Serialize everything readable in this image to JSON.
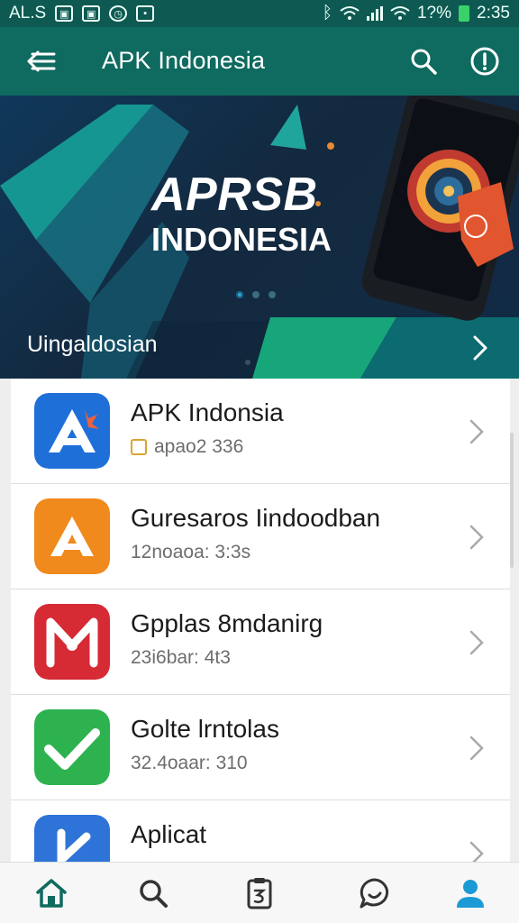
{
  "status_bar": {
    "carrier": "AL.S",
    "icons": [
      "image-icon",
      "image-icon",
      "clock-icon",
      "notification-icon",
      "bluetooth-icon",
      "wifi-icon",
      "signal-icon",
      "wifi-icon"
    ],
    "battery": "1?%",
    "time": "2:35"
  },
  "app_bar": {
    "title": "APK Indonesia",
    "back_icon": "back-menu-icon",
    "search_icon": "search-icon",
    "info_icon": "info-icon",
    "color": "#0f6a5f"
  },
  "banner": {
    "title_line1": "APRSB",
    "title_line2": "INDONESIA",
    "caption": "Uingaldosian",
    "next_icon": "chevron-right-icon",
    "dots": 3
  },
  "apps": [
    {
      "name": "APK Indonsia",
      "meta": "apao2 336",
      "icon": "apk-logo-icon",
      "color": "#1f6fd9"
    },
    {
      "name": "Guresaros Iindoodban",
      "meta": "12noaoa: 3:3s",
      "icon": "a-logo-icon",
      "color": "#f08a1c"
    },
    {
      "name": "Gpplas 8mdanirg",
      "meta": "23i6bar: 4t3",
      "icon": "m-logo-icon",
      "color": "#d62a35"
    },
    {
      "name": "Golte lrntolas",
      "meta": "32.4oaar: 310",
      "icon": "check-logo-icon",
      "color": "#2db24f"
    },
    {
      "name": "Aplicat",
      "meta": "",
      "icon": "k-logo-icon",
      "color": "#2e74d8"
    }
  ],
  "bottom_nav": [
    {
      "icon": "home-icon",
      "active": false
    },
    {
      "icon": "search-icon",
      "active": false
    },
    {
      "icon": "document-icon",
      "active": false
    },
    {
      "icon": "chat-icon",
      "active": false
    },
    {
      "icon": "profile-icon",
      "active": true
    }
  ],
  "colors": {
    "accent": "#0f6a5f",
    "active_nav": "#1b9ad6"
  }
}
